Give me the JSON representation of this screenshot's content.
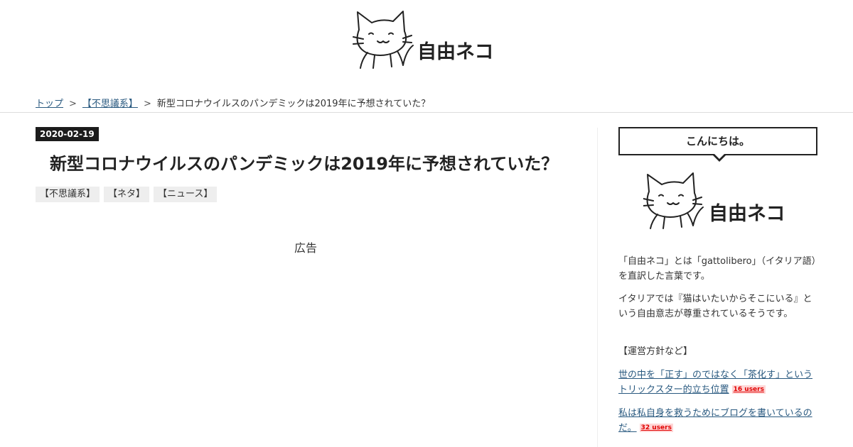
{
  "header": {
    "logo_text": "自由ネコ"
  },
  "breadcrumb": {
    "items": [
      "トップ",
      "【不思議系】"
    ],
    "current": "新型コロナウイルスのパンデミックは2019年に予想されていた？",
    "separator": ">"
  },
  "post": {
    "date": "2020-02-19",
    "title": "新型コロナウイルスのパンデミックは2019年に予想されていた？",
    "tags": [
      "【不思議系】",
      "【ネタ】",
      "【ニュース】"
    ],
    "ad_label": "広告"
  },
  "sidebar": {
    "greeting": "こんにちは。",
    "logo_text": "自由ネコ",
    "intro_1": "「自由ネコ」とは「gattolibero」（イタリア語）を直訳した言葉です。",
    "intro_2": "イタリアでは『猫はいたいからそこにいる』という自由意志が尊重されているそうです。",
    "policy_heading": "【運営方針など】",
    "links": [
      {
        "text": "世の中を「正す」のではなく「茶化す」というトリックスター的立ち位置",
        "users": "16 users"
      },
      {
        "text": "私は私自身を救うためにブログを書いているのだ。",
        "users": "32 users"
      }
    ]
  },
  "colors": {
    "link": "#2a5a80",
    "date_badge_bg": "#1c1c1c",
    "users_badge": "#e00000"
  }
}
